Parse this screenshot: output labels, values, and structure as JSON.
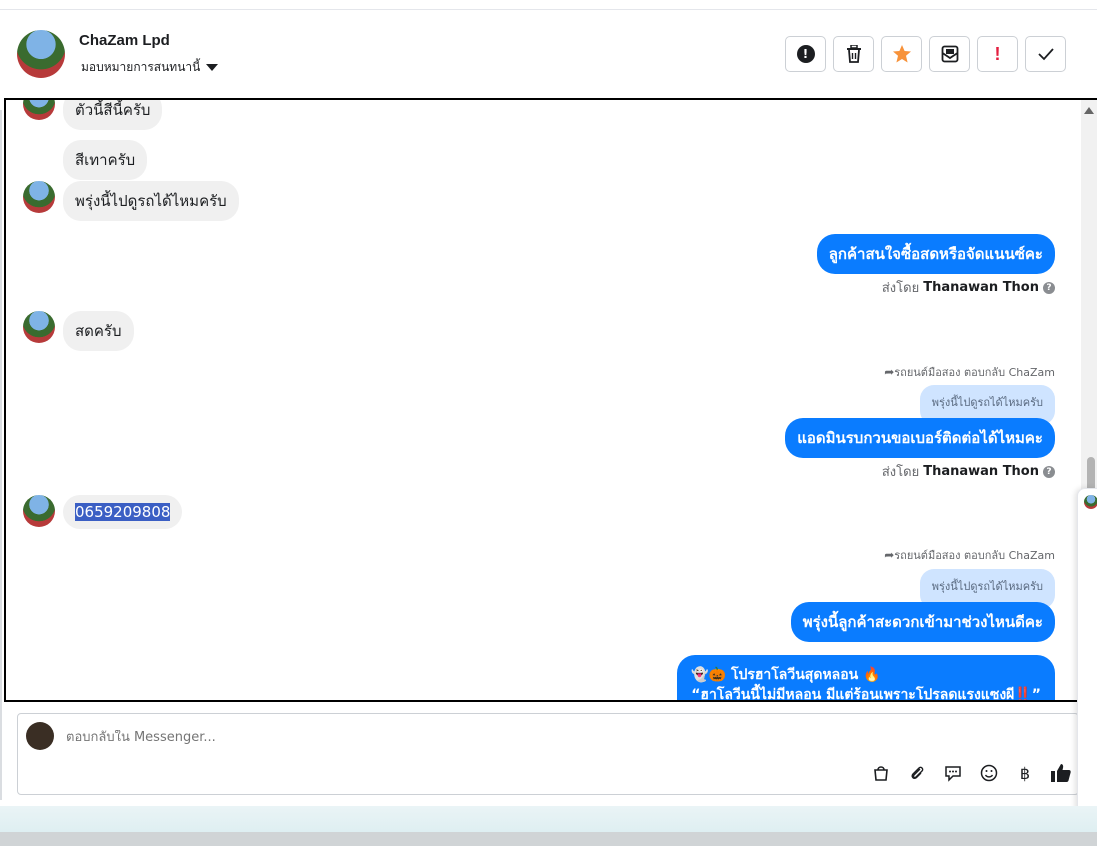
{
  "header": {
    "name": "ChaZam Lpd",
    "assign_label": "มอบหมายการสนทนานี้",
    "tools": [
      {
        "icon": "alert-circle-icon",
        "symbol": "!"
      },
      {
        "icon": "trash-icon",
        "symbol": "🗑"
      },
      {
        "icon": "star-icon",
        "symbol": "★",
        "color": "#f7923a"
      },
      {
        "icon": "mark-unread-icon",
        "symbol": "✉"
      },
      {
        "icon": "spam-icon",
        "symbol": "!",
        "color": "#e41e3f"
      },
      {
        "icon": "done-check-icon",
        "symbol": "✓"
      }
    ]
  },
  "messages": {
    "m1": "ตัวนี้สีนี้ครับ",
    "m2": "สีเทาครับ",
    "m3": "พรุ่งนี้ไปดูรถได้ไหมครับ",
    "m4": "ลูกค้าสนใจซื้อสดหรือจัดแนนซ์คะ",
    "m4_sent_prefix": "ส่งโดย",
    "m4_sent_name": "Thanawan Thon",
    "m5": "สดครับ",
    "m6_reply_meta": "รถยนต์มือสอง ตอบกลับ ChaZam",
    "m6_quote": "พรุ่งนี้ไปดูรถได้ไหมครับ",
    "m6": "แอดมินรบกวนขอเบอร์ติดต่อได้ไหมคะ",
    "m6_sent_prefix": "ส่งโดย",
    "m6_sent_name": "Thanawan Thon",
    "m7": "0659209808",
    "m8_reply_meta": "รถยนต์มือสอง ตอบกลับ ChaZam",
    "m8_quote": "พรุ่งนี้ไปดูรถได้ไหมครับ",
    "m8": "พรุ่งนี้ลูกค้าสะดวกเข้ามาช่วงไหนดีคะ",
    "m9_line1": "👻🎃 โปรฮาโลวีนสุดหลอน 🔥",
    "m9_line2": "“ฮาโลวีนนี้ไม่มีหลอน มีแต่ร้อนเพราะโปรลดแรงแซงผี‼️”"
  },
  "composer": {
    "placeholder": "ตอบกลับใน Messenger..."
  },
  "colors": {
    "outgoing": "#0a7cff",
    "incoming": "#f0f0f0",
    "reply_quote": "#cfe4ff"
  }
}
